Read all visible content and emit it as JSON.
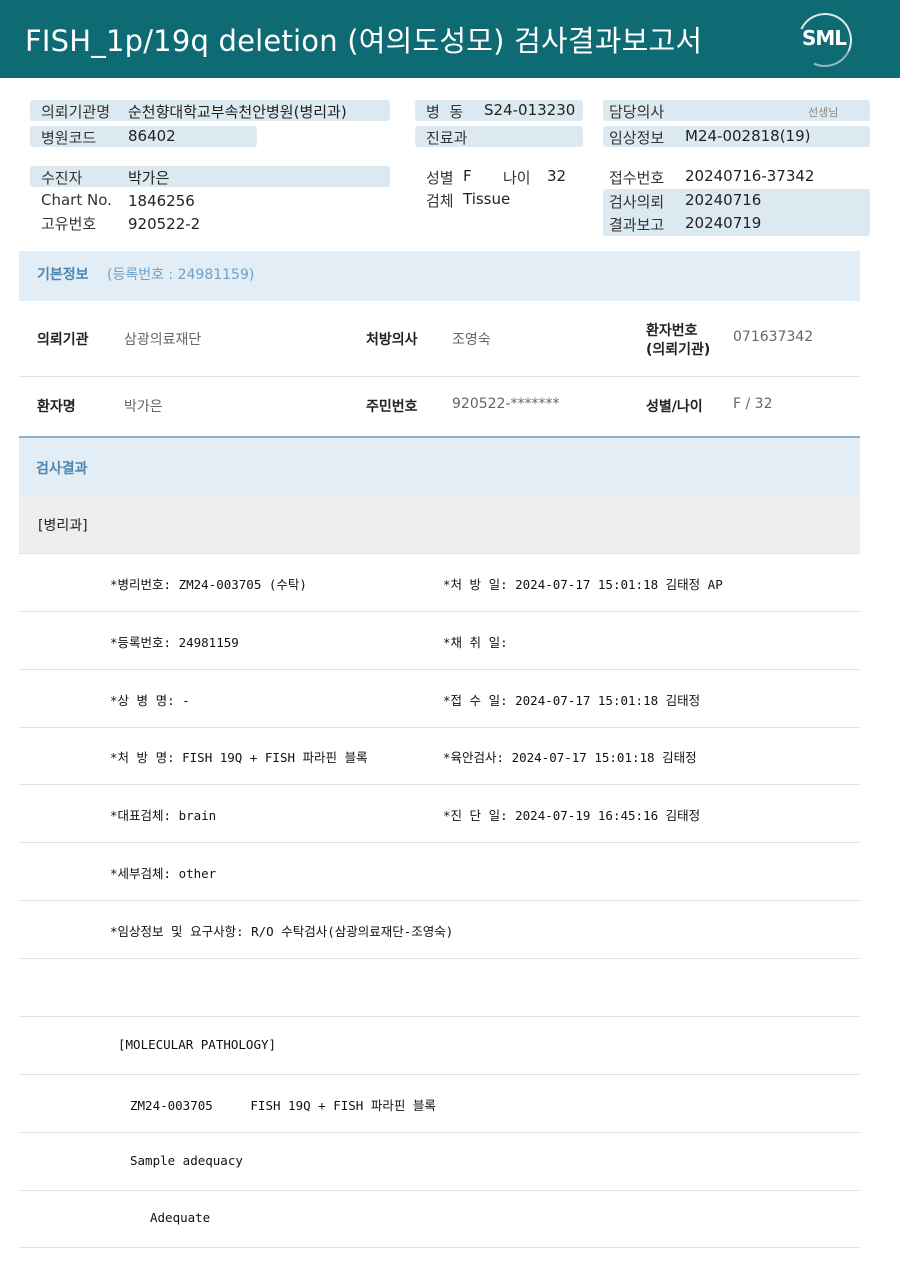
{
  "header": {
    "title": "FISH_1p/19q  deletion (여의도성모) 검사결과보고서",
    "logo": "SML"
  },
  "info": {
    "req_inst_label": "의뢰기관명",
    "req_inst": "순천향대학교부속천안병원(병리과)",
    "hosp_code_label": "병원코드",
    "hosp_code": "86402",
    "ward_label": "병  동",
    "ward": "S24-013230",
    "dept_label": "진료과",
    "dept": "",
    "doctor_label": "담당의사",
    "doctor": "",
    "doctor_suffix": "선생님",
    "clinical_label": "임상정보",
    "clinical": "M24-002818(19)",
    "patient_label": "수진자",
    "patient": "박가은",
    "chart_label": "Chart No.",
    "chart": "1846256",
    "uid_label": "고유번호",
    "uid": "920522-2",
    "sex_label": "성별",
    "sex": "F",
    "age_label": "나이",
    "age": "32",
    "specimen_label": "검체",
    "specimen": "Tissue",
    "receipt_label": "접수번호",
    "receipt": "20240716-37342",
    "request_label": "검사의뢰",
    "request": "20240716",
    "report_label": "결과보고",
    "report": "20240719"
  },
  "basic": {
    "title": "기본정보",
    "subtitle": "(등록번호 : 24981159)",
    "inst_key": "의뢰기관",
    "inst_val": "삼광의료재단",
    "presc_key": "처방의사",
    "presc_val": "조영숙",
    "pno_key1": "환자번호",
    "pno_key2": "(의뢰기관)",
    "pno_val": "071637342",
    "name_key": "환자명",
    "name_val": "박가은",
    "rrn_key": "주민번호",
    "rrn_val": "920522-*******",
    "sexage_key": "성별/나이",
    "sexage_val": "F / 32"
  },
  "results": {
    "title": "검사결과",
    "department": "[병리과]",
    "lines": [
      {
        "left": "*병리번호: ZM24-003705 (수탁)",
        "right": "*처 방 일: 2024-07-17 15:01:18  김태정 AP"
      },
      {
        "left": "*등록번호: 24981159",
        "right": "*채 취 일:"
      },
      {
        "left": "*상 병 명: -",
        "right": "*접 수 일: 2024-07-17 15:01:18  김태정"
      },
      {
        "left": "*처 방 명: FISH 19Q + FISH 파라핀 블록",
        "right": "*육안검사: 2024-07-17 15:01:18  김태정"
      },
      {
        "left": "*대표검체: brain",
        "right": "*진 단 일: 2024-07-19 16:45:16  김태정"
      },
      {
        "left": "*세부검체: other",
        "right": ""
      },
      {
        "left": "*임상정보 및 요구사항: R/O 수탁검사(삼광의료재단-조영숙)",
        "right": ""
      }
    ],
    "mol_header": "[MOLECULAR PATHOLOGY]",
    "mol_line": "ZM24-003705     FISH 19Q + FISH 파라핀 블록",
    "adequacy_label": "Sample adequacy",
    "adequacy_value": "Adequate"
  }
}
